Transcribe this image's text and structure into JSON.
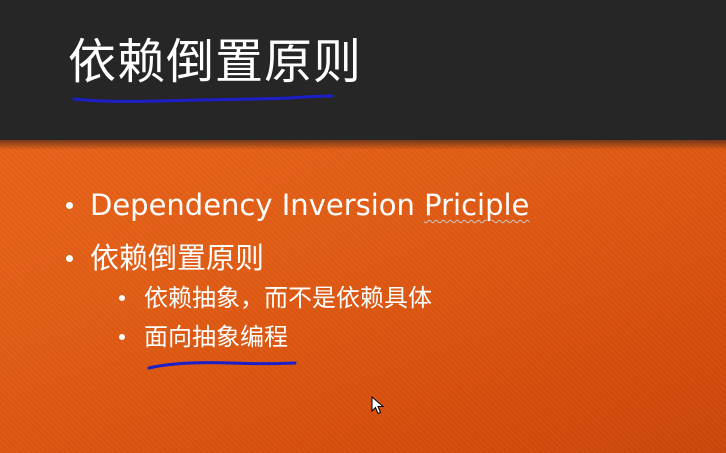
{
  "slide": {
    "title": "依赖倒置原则",
    "bullets": [
      {
        "pre": "Dependency Inversion ",
        "misspelled": "Priciple"
      },
      {
        "text": "依赖倒置原则"
      }
    ],
    "sub_bullets": [
      {
        "text": "依赖抽象，而不是依赖具体"
      },
      {
        "text": "面向抽象编程"
      }
    ]
  },
  "annotations": {
    "ink_color": "#1b1fc7",
    "items": [
      "title-underline-stroke",
      "sub-bullet-underline-stroke"
    ]
  },
  "cursor": {
    "icon": "mouse-pointer-icon"
  },
  "colors": {
    "title_band": "#262626",
    "body_accent": "#e15d14",
    "text": "#ffffff"
  }
}
